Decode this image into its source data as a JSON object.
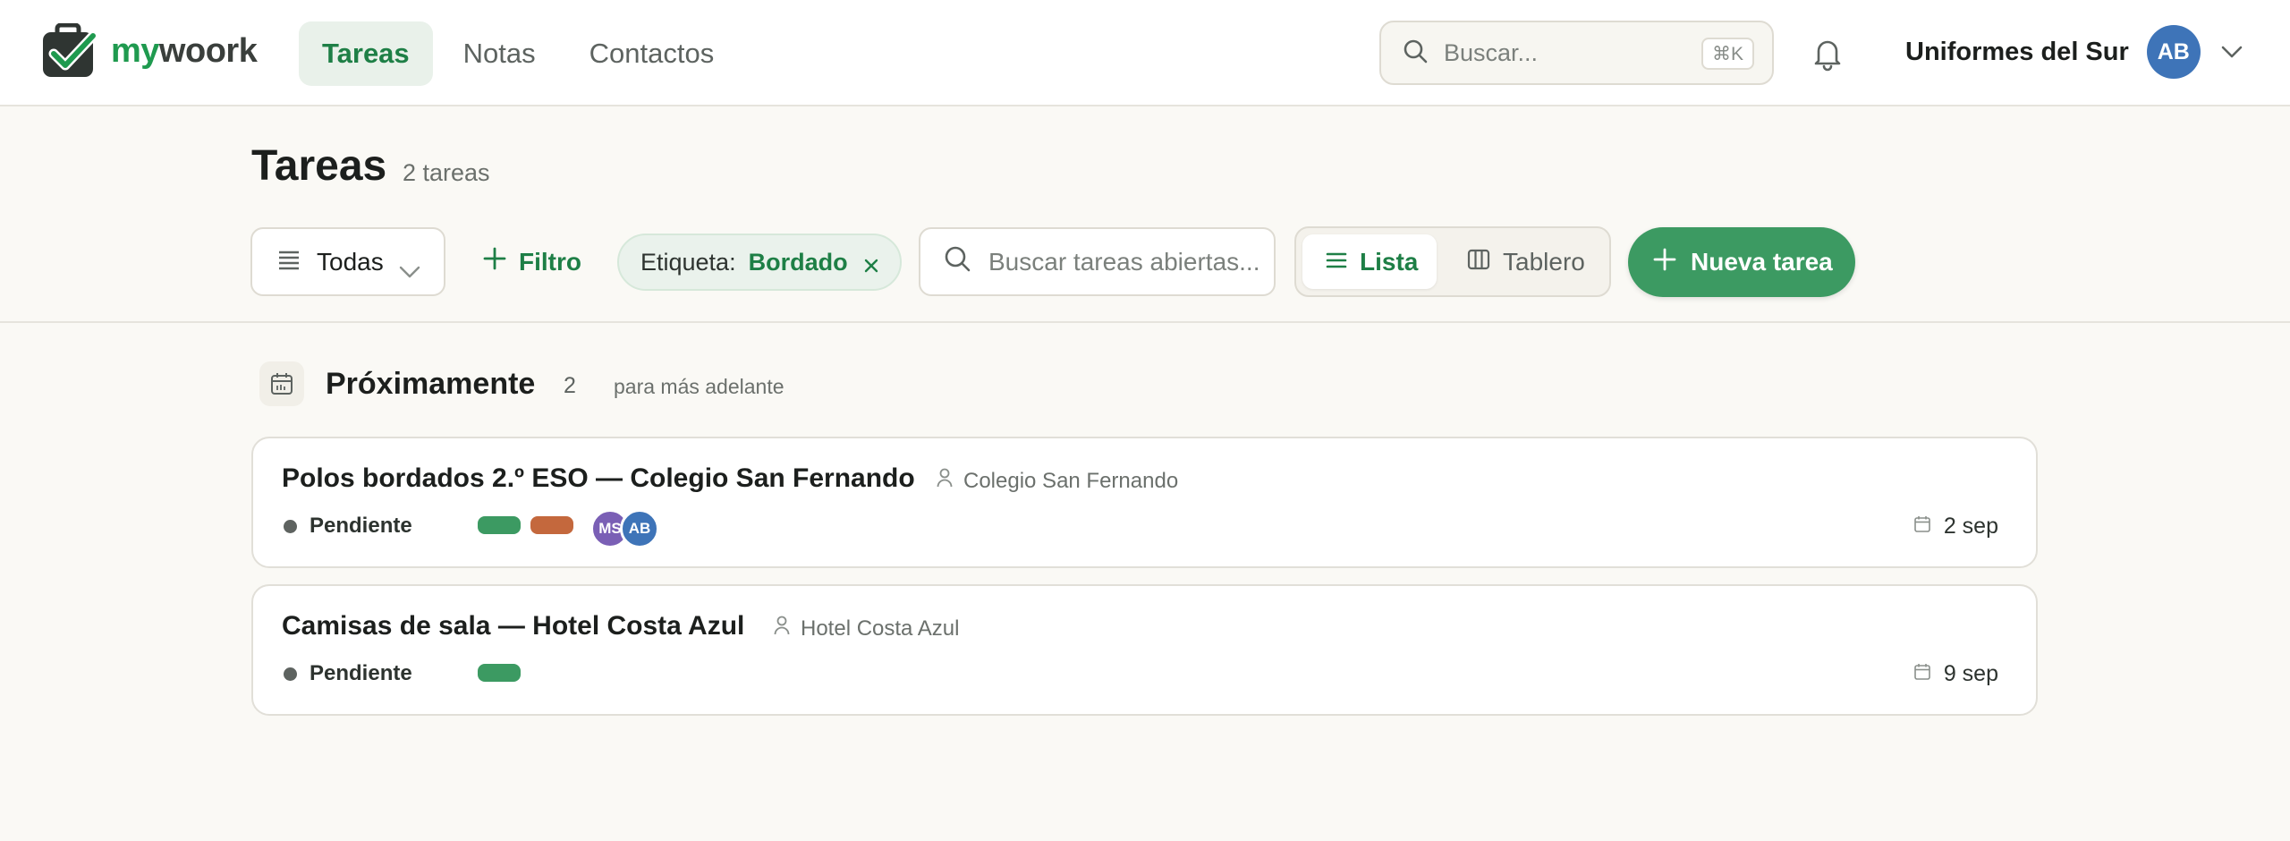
{
  "app": {
    "logo_left": "my",
    "logo_right": "woork"
  },
  "nav": {
    "items": [
      {
        "label": "Tareas",
        "active": true
      },
      {
        "label": "Notas",
        "active": false
      },
      {
        "label": "Contactos",
        "active": false
      }
    ]
  },
  "global_search": {
    "placeholder": "Buscar...",
    "shortcut": "⌘K"
  },
  "account": {
    "org_name": "Uniformes del Sur",
    "initials": "AB"
  },
  "page": {
    "title": "Tareas",
    "count_label": "2 tareas"
  },
  "filters": {
    "scope_label": "Todas",
    "add_filter_label": "Filtro",
    "active_tag": {
      "key": "Etiqueta:",
      "value": "Bordado"
    },
    "search_placeholder": "Buscar tareas abiertas...",
    "views": [
      {
        "label": "Lista",
        "active": true
      },
      {
        "label": "Tablero",
        "active": false
      }
    ],
    "new_task_label": "Nueva tarea"
  },
  "section": {
    "title": "Próximamente",
    "count": "2",
    "subtitle": "para más adelante"
  },
  "tasks": [
    {
      "title": "Polos bordados 2.º ESO — Colegio San Fernando",
      "client": "Colegio San Fernando",
      "status": "Pendiente",
      "tags": [
        "green",
        "orange"
      ],
      "assignees": [
        "MS",
        "AB"
      ],
      "due": "2 sep"
    },
    {
      "title": "Camisas de sala — Hotel Costa Azul",
      "client": "Hotel Costa Azul",
      "status": "Pendiente",
      "tags": [
        "green"
      ],
      "assignees": [],
      "due": "9 sep"
    }
  ],
  "colors": {
    "brand_green": "#1f9a4f",
    "primary_button": "#3c9a62",
    "tag_green": "#3c9a62",
    "tag_orange": "#c4683d",
    "avatar_blue": "#3e74b8",
    "avatar_purple": "#7a5fb5"
  }
}
